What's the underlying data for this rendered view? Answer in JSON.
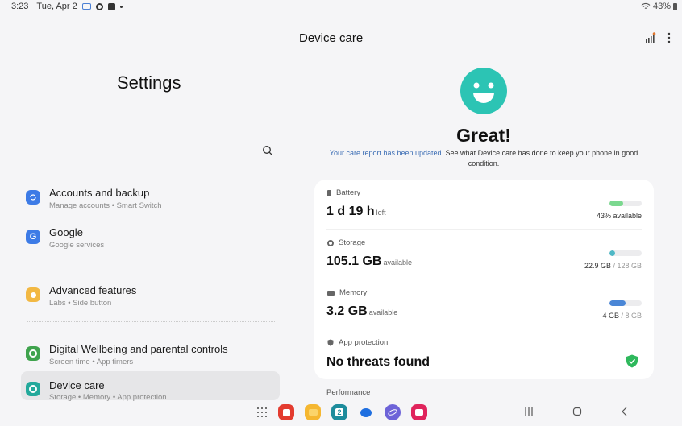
{
  "status_bar": {
    "time": "3:23",
    "date": "Tue, Apr 2",
    "battery": "43%"
  },
  "left": {
    "title": "Settings",
    "items": [
      {
        "title": "Accounts and backup",
        "subtitle": "Manage accounts • Smart Switch",
        "icon": "sync-icon",
        "color": "#3d7be6"
      },
      {
        "title": "Google",
        "subtitle": "Google services",
        "icon": "google-icon",
        "color": "#3d7be6"
      },
      {
        "title": "Advanced features",
        "subtitle": "Labs • Side button",
        "icon": "gear-plus-icon",
        "color": "#f2b843"
      },
      {
        "title": "Digital Wellbeing and parental controls",
        "subtitle": "Screen time • App timers",
        "icon": "wellbeing-icon",
        "color": "#3fa34d"
      },
      {
        "title": "Device care",
        "subtitle": "Storage • Memory • App protection",
        "icon": "device-care-icon",
        "color": "#23a99b"
      }
    ]
  },
  "right": {
    "title": "Device care",
    "status": "Great!",
    "report_link": "Your care report has been updated.",
    "report_text": " See what Device care has done to keep your phone in good condition.",
    "accent": "#2cc4b4",
    "rows": [
      {
        "label": "Battery",
        "value": "1 d 19 h",
        "unit": "left",
        "caption_main": "43% available",
        "caption_muted": "",
        "fill": 0.43,
        "color": "#7bd88f"
      },
      {
        "label": "Storage",
        "value": "105.1 GB",
        "unit": "available",
        "caption_main": "22.9 GB",
        "caption_muted": " / 128 GB",
        "fill": 0.18,
        "color": "#4fb8c6"
      },
      {
        "label": "Memory",
        "value": "3.2 GB",
        "unit": "available",
        "caption_main": "4 GB",
        "caption_muted": " / 8 GB",
        "fill": 0.5,
        "color": "#4a86d6"
      },
      {
        "label": "App protection",
        "value": "No threats found",
        "unit": "",
        "status_color": "#2eb85c"
      }
    ],
    "performance_label": "Performance"
  },
  "dock": {
    "calendar_day": "2"
  }
}
